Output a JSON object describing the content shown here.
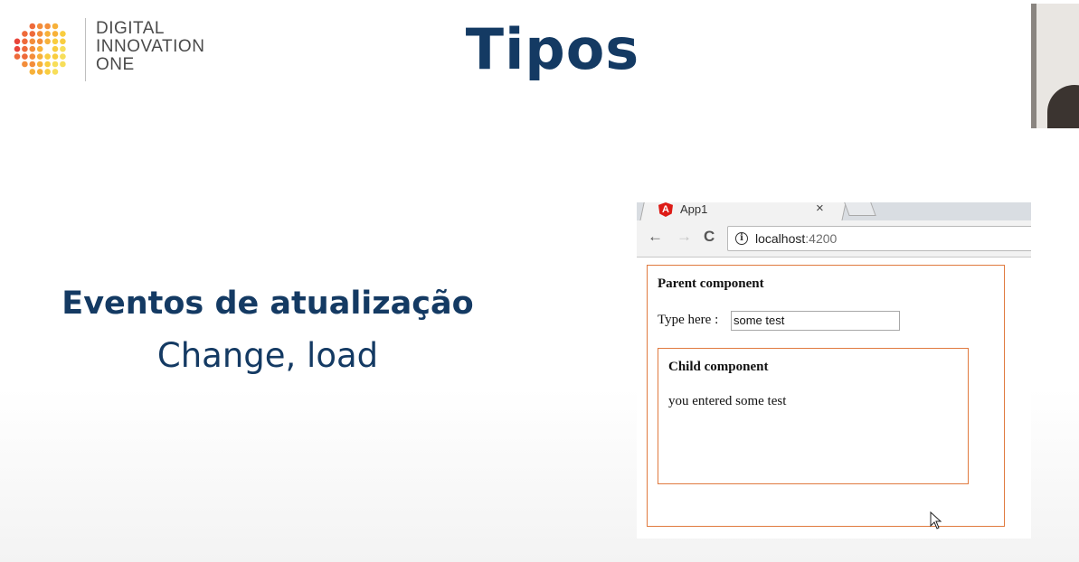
{
  "logo": {
    "line1": "DIGITAL",
    "line2": "INNOVATION",
    "line3": "ONE"
  },
  "slide": {
    "title": "Tipos",
    "subtitle": "Eventos de atualização",
    "subtitle2": "Change, load",
    "title_color": "#143a63"
  },
  "browser": {
    "tab_title": "App1",
    "tab_close": "×",
    "tab_icon": "angular-logo-icon",
    "nav": {
      "back": "←",
      "forward": "→",
      "reload": "C",
      "info": "i"
    },
    "url_host": "localhost",
    "url_port": ":4200",
    "parent": {
      "title": "Parent component",
      "label": "Type here :",
      "input_value": "some test"
    },
    "child": {
      "title": "Child component",
      "text": "you entered some test"
    },
    "accent": "#e07a3f"
  }
}
